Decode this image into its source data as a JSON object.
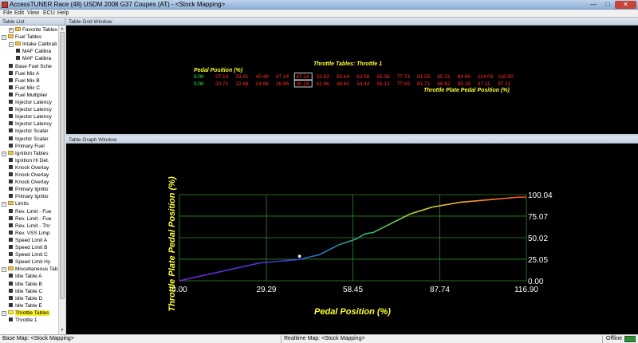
{
  "window": {
    "title": "AccessTUNER Race (48) USDM 2008 G37 Coupes (AT) - <Stock Mapping>",
    "minimize_glyph": "—",
    "maximize_glyph": "□",
    "close_glyph": "✕"
  },
  "menu": [
    "File",
    "Edit",
    "View",
    "ECU",
    "Help"
  ],
  "left_panel": {
    "caption": "Table List",
    "tree": [
      {
        "label": "Favorite Tables",
        "level": 1,
        "kind": "folder",
        "expander": "+"
      },
      {
        "label": "Fuel Tables",
        "level": 0,
        "kind": "folder",
        "expander": "−"
      },
      {
        "label": "Intake Calibrati",
        "level": 1,
        "kind": "folder",
        "expander": "−"
      },
      {
        "label": "MAF Calibra",
        "level": 2,
        "kind": "table"
      },
      {
        "label": "MAF Calibra",
        "level": 2,
        "kind": "table"
      },
      {
        "label": "Base Fuel Sche",
        "level": 1,
        "kind": "table"
      },
      {
        "label": "Fuel Mix A",
        "level": 1,
        "kind": "table"
      },
      {
        "label": "Fuel Mix B",
        "level": 1,
        "kind": "table"
      },
      {
        "label": "Fuel Mix C",
        "level": 1,
        "kind": "table"
      },
      {
        "label": "Fuel Multiplier",
        "level": 1,
        "kind": "table"
      },
      {
        "label": "Injector Latency",
        "level": 1,
        "kind": "table"
      },
      {
        "label": "Injector Latency",
        "level": 1,
        "kind": "table"
      },
      {
        "label": "Injector Latency",
        "level": 1,
        "kind": "table"
      },
      {
        "label": "Injector Latency",
        "level": 1,
        "kind": "table"
      },
      {
        "label": "Injector Scalar",
        "level": 1,
        "kind": "table"
      },
      {
        "label": "Injector Scalar",
        "level": 1,
        "kind": "table"
      },
      {
        "label": "Primary Fuel",
        "level": 1,
        "kind": "table"
      },
      {
        "label": "Ignition Tables",
        "level": 0,
        "kind": "folder",
        "expander": "−"
      },
      {
        "label": "Ignition Hi Det.",
        "level": 1,
        "kind": "table"
      },
      {
        "label": "Knock Overlay",
        "level": 1,
        "kind": "table"
      },
      {
        "label": "Knock Overlay",
        "level": 1,
        "kind": "table"
      },
      {
        "label": "Knock Overlay",
        "level": 1,
        "kind": "table"
      },
      {
        "label": "Primary Ignitio",
        "level": 1,
        "kind": "table"
      },
      {
        "label": "Primary Ignitio",
        "level": 1,
        "kind": "table"
      },
      {
        "label": "Limits",
        "level": 0,
        "kind": "folder",
        "expander": "−"
      },
      {
        "label": "Rev. Limit - Fue",
        "level": 1,
        "kind": "table"
      },
      {
        "label": "Rev. Limit - Fue",
        "level": 1,
        "kind": "table"
      },
      {
        "label": "Rev. Limit - Thr",
        "level": 1,
        "kind": "table"
      },
      {
        "label": "Rev. VSS Limp",
        "level": 1,
        "kind": "table"
      },
      {
        "label": "Speed Limit A",
        "level": 1,
        "kind": "table"
      },
      {
        "label": "Speed Limit B",
        "level": 1,
        "kind": "table"
      },
      {
        "label": "Speed Limit C",
        "level": 1,
        "kind": "table"
      },
      {
        "label": "Speed Limit Hy",
        "level": 1,
        "kind": "table"
      },
      {
        "label": "Miscellaneous Tab",
        "level": 0,
        "kind": "folder",
        "expander": "−"
      },
      {
        "label": "Idle Table A",
        "level": 1,
        "kind": "table"
      },
      {
        "label": "Idle Table B",
        "level": 1,
        "kind": "table"
      },
      {
        "label": "Idle Table C",
        "level": 1,
        "kind": "table"
      },
      {
        "label": "Idle Table D",
        "level": 1,
        "kind": "table"
      },
      {
        "label": "Idle Table E",
        "level": 1,
        "kind": "table"
      },
      {
        "label": "Throttle Tables",
        "level": 0,
        "kind": "folder",
        "expander": "−",
        "highlight": true
      },
      {
        "label": "Throttle 1",
        "level": 1,
        "kind": "table"
      }
    ]
  },
  "grid_window": {
    "caption": "Table Grid Window",
    "table_title": "Throttle Tables: Throttle 1",
    "row_axis_label": "Pedal Position (%)",
    "col_axis_label": "Throttle Plate Pedal Position (%)",
    "row1_label": "0.00",
    "row1": [
      "27.14",
      "33.81",
      "40.48",
      "47.14",
      "47.14",
      "53.83",
      "59.64",
      "62.56",
      "65.36",
      "77.74",
      "81.55",
      "85.21",
      "84.66",
      "114.09",
      "116.90"
    ],
    "row2_label": "0.00",
    "row2": [
      "20.72",
      "22.68",
      "24.96",
      "26.96",
      "30.18",
      "41.96",
      "48.60",
      "54.44",
      "56.13",
      "77.65",
      "81.71",
      "88.62",
      "95.18",
      "97.11",
      "97.11"
    ],
    "selected_index": 4,
    "colors": {
      "title": "#ffff33",
      "row1": "#ff2a2a",
      "row2": "#ff2a2a",
      "axis_value": "#33ff33"
    }
  },
  "graph_window": {
    "caption": "Table Graph Window"
  },
  "chart_data": {
    "type": "line",
    "title": "",
    "xlabel": "Pedal Position (%)",
    "ylabel": "Throttle Plate Pedal Position (%)",
    "xlim": [
      0,
      116.9
    ],
    "ylim": [
      0,
      100.04
    ],
    "x_ticks": [
      "0.00",
      "29.29",
      "58.45",
      "87.74",
      "116.90"
    ],
    "y_ticks": [
      "0.00",
      "25.05",
      "50.02",
      "75.07",
      "100.04"
    ],
    "grid": true,
    "series": [
      {
        "x": [
          0,
          27.14,
          33.81,
          40.48,
          47.14,
          53.83,
          59.64,
          62.56,
          65.36,
          77.74,
          81.55,
          85.21,
          94.66,
          114.09,
          116.9
        ],
        "y": [
          0,
          20.72,
          22.68,
          24.96,
          30.18,
          41.96,
          48.6,
          54.44,
          56.13,
          77.65,
          81.71,
          85.62,
          91.18,
          97.11,
          97.11
        ]
      }
    ],
    "marker": {
      "x": 40.48,
      "y": 28.5
    },
    "colors": {
      "axis_label": "#ffff33",
      "tick": "#ffffff",
      "grid": "#2e8b2e"
    }
  },
  "status_bar": {
    "base_map": "Base Map: <Stock Mapping>",
    "realtime_map": "Realtime Map: <Stock Mapping>",
    "state": "Offline"
  }
}
